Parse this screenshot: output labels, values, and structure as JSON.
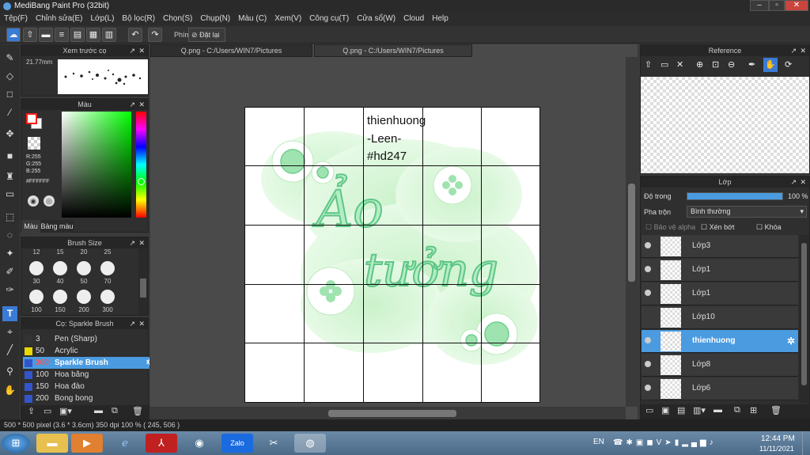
{
  "window": {
    "title": "MediBang Paint Pro (32bit)",
    "minimize": "–",
    "maximize": "▫",
    "close": "✕"
  },
  "menu": [
    "Tệp(F)",
    "Chỉnh sửa(E)",
    "Lớp(L)",
    "Bộ lọc(R)",
    "Chọn(S)",
    "Chụp(N)",
    "Màu (C)",
    "Xem(V)",
    "Công cụ(T)",
    "Cửa sổ(W)",
    "Cloud",
    "Help"
  ],
  "toolbar": {
    "keys_label": "Phím",
    "reset_label": "Đặt lại"
  },
  "preview": {
    "title": "Xem trước cọ",
    "zoom": "21.77mm"
  },
  "color": {
    "title": "Màu",
    "r": "R:255",
    "g": "G:255",
    "b": "B:255",
    "hex": "#FFFFFF",
    "tab_color": "Màu",
    "tab_palette": "Bảng màu",
    "fg": "#ff1a1a"
  },
  "brush_size": {
    "title": "Brush Size",
    "labels_top": [
      "12",
      "15",
      "20",
      "25"
    ],
    "labels_mid": [
      "30",
      "40",
      "50",
      "70"
    ],
    "labels_bot": [
      "100",
      "150",
      "200",
      "300"
    ]
  },
  "brush_list": {
    "title": "Cọ: Sparkle Brush",
    "items": [
      {
        "size": "3",
        "name": "Pen (Sharp)",
        "color": "#333333"
      },
      {
        "size": "50",
        "name": "Acrylic",
        "color": "#e8d800"
      },
      {
        "size": "300",
        "name": "Sparkle Brush",
        "color": "#3355cc"
      },
      {
        "size": "100",
        "name": "Hoa băng",
        "color": "#3355cc"
      },
      {
        "size": "150",
        "name": "Hoa đào",
        "color": "#3355cc"
      },
      {
        "size": "200",
        "name": "Bong bong",
        "color": "#3355cc"
      }
    ]
  },
  "tabs": [
    "Q.png - C:/Users/WIN7/Pictures",
    "Q.png - C:/Users/WIN7/Pictures"
  ],
  "canvas": {
    "line1": "thienhuong",
    "line2": "-Leen-",
    "line3": "#hd247",
    "art_text1": "Ảo",
    "art_text2": "tưởng"
  },
  "reference": {
    "title": "Reference"
  },
  "layers": {
    "title": "Lớp",
    "opacity_label": "Độ trong",
    "opacity_value": "100 %",
    "opacity_fraction": 1.0,
    "blend_label": "Pha trộn",
    "blend_value": "Bình thường",
    "protect_alpha": "Bảo vệ alpha",
    "clip": "Xén bớt",
    "lock": "Khóa",
    "items": [
      "Lớp3",
      "Lớp1",
      "Lớp1",
      "Lớp10",
      "thienhuong",
      "Lớp8",
      "Lớp6"
    ]
  },
  "status": "500 * 500 pixel  (3.6 * 3.6cm)  350 dpi  100 %  ( 245, 506 )",
  "taskbar": {
    "lang": "EN",
    "time": "12:44 PM",
    "date": "11/11/2021"
  }
}
